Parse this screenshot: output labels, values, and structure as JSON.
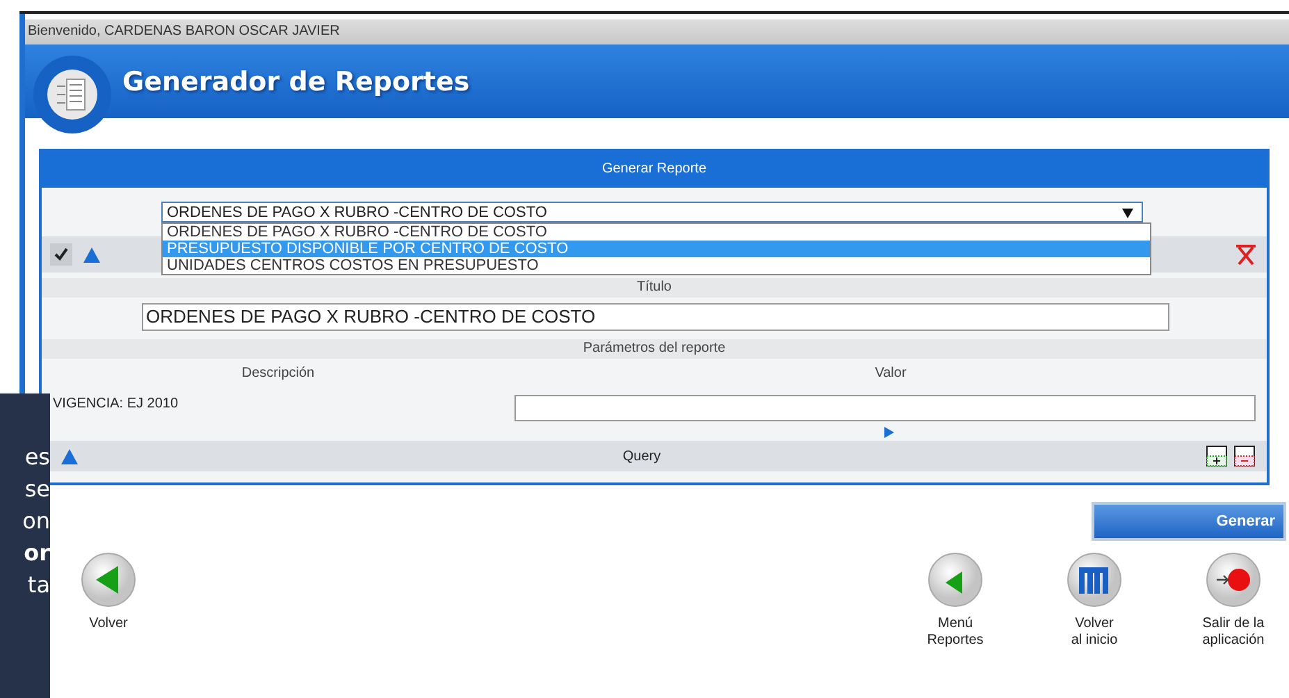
{
  "welcome": "Bienvenido, CARDENAS BARON OSCAR JAVIER",
  "header": {
    "title": "Generador de Reportes"
  },
  "panel": {
    "title": "Generar Reporte",
    "report_select": {
      "value": "ORDENES DE PAGO X RUBRO -CENTRO DE COSTO",
      "expanded": true,
      "options": [
        {
          "label": "ORDENES DE PAGO X RUBRO -CENTRO DE COSTO",
          "highlighted": false
        },
        {
          "label": "PRESUPUESTO DISPONIBLE POR CENTRO DE COSTO",
          "highlighted": true
        },
        {
          "label": "UNIDADES CENTROS COSTOS EN PRESUPUESTO",
          "highlighted": false
        }
      ]
    },
    "titulo_label": "Título",
    "titulo_value": "ORDENES DE PAGO X RUBRO -CENTRO DE COSTO",
    "params_title": "Parámetros del reporte",
    "columns": [
      "Descripción",
      "Valor"
    ],
    "params": [
      {
        "description": "VIGENCIA: EJ 2010"
      }
    ],
    "query_label": "Query"
  },
  "generate_button": "Generar",
  "nav": [
    {
      "label": "Volver",
      "kind": "back"
    },
    {
      "label": "Menú\nReportes",
      "kind": "menu"
    },
    {
      "label": "Volver\nal inicio",
      "kind": "home"
    },
    {
      "label": "Salir de la\naplicación",
      "kind": "exit"
    }
  ],
  "side_note": [
    {
      "text": "es",
      "bold": false
    },
    {
      "text": "se",
      "bold": false
    },
    {
      "text": "on",
      "bold": false
    },
    {
      "text": "or",
      "bold": true
    },
    {
      "text": "ta",
      "bold": false
    }
  ]
}
